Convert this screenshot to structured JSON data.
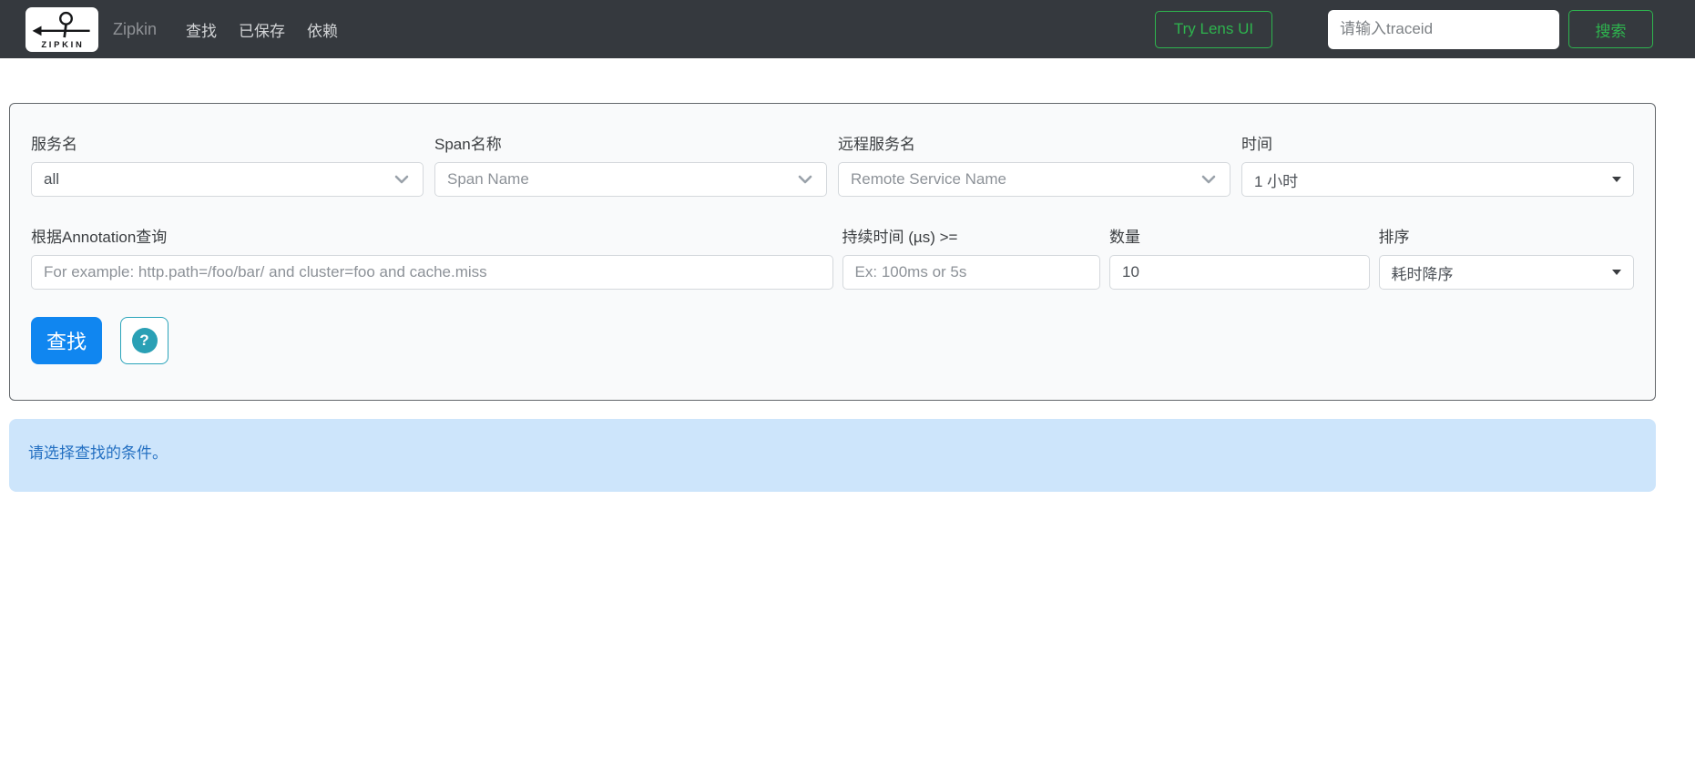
{
  "navbar": {
    "brand": "Zipkin",
    "logo_text": "ZIPKIN",
    "links": [
      {
        "label": "查找"
      },
      {
        "label": "已保存"
      },
      {
        "label": "依赖"
      }
    ],
    "try_lens_label": "Try Lens UI",
    "trace_placeholder": "请输入traceid",
    "search_label": "搜索"
  },
  "search_form": {
    "fields": {
      "service": {
        "label": "服务名",
        "value": "all"
      },
      "span": {
        "label": "Span名称",
        "value": "Span Name"
      },
      "remote": {
        "label": "远程服务名",
        "value": "Remote Service Name"
      },
      "lookback": {
        "label": "时间",
        "value": "1 小时"
      },
      "annotation": {
        "label": "根据Annotation查询",
        "placeholder": "For example: http.path=/foo/bar/ and cluster=foo and cache.miss"
      },
      "duration": {
        "label": "持续时间 (µs) >=",
        "placeholder": "Ex: 100ms or 5s"
      },
      "limit": {
        "label": "数量",
        "value": "10"
      },
      "sort": {
        "label": "排序",
        "value": "耗时降序"
      }
    },
    "find_label": "查找",
    "help_glyph": "?"
  },
  "alert": {
    "message": "请选择查找的条件。"
  },
  "colors": {
    "navbar_bg": "#35393e",
    "accent_green": "#2eb44e",
    "accent_blue": "#1086f0",
    "help_teal": "#2aa0b5",
    "alert_bg": "#cde5fb",
    "alert_text": "#2470c2"
  }
}
